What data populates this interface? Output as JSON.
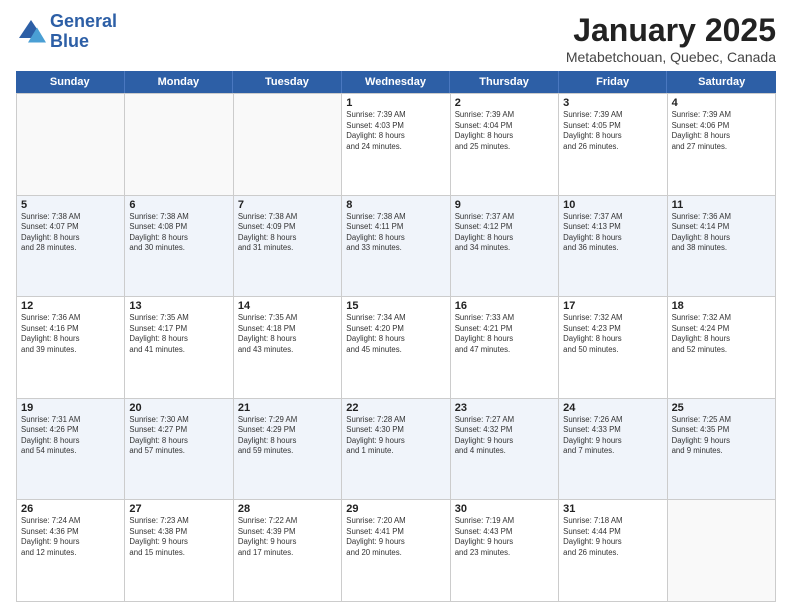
{
  "header": {
    "logo_general": "General",
    "logo_blue": "Blue",
    "month_title": "January 2025",
    "subtitle": "Metabetchouan, Quebec, Canada"
  },
  "weekdays": [
    "Sunday",
    "Monday",
    "Tuesday",
    "Wednesday",
    "Thursday",
    "Friday",
    "Saturday"
  ],
  "weeks": [
    [
      {
        "day": "",
        "info": ""
      },
      {
        "day": "",
        "info": ""
      },
      {
        "day": "",
        "info": ""
      },
      {
        "day": "1",
        "info": "Sunrise: 7:39 AM\nSunset: 4:03 PM\nDaylight: 8 hours\nand 24 minutes."
      },
      {
        "day": "2",
        "info": "Sunrise: 7:39 AM\nSunset: 4:04 PM\nDaylight: 8 hours\nand 25 minutes."
      },
      {
        "day": "3",
        "info": "Sunrise: 7:39 AM\nSunset: 4:05 PM\nDaylight: 8 hours\nand 26 minutes."
      },
      {
        "day": "4",
        "info": "Sunrise: 7:39 AM\nSunset: 4:06 PM\nDaylight: 8 hours\nand 27 minutes."
      }
    ],
    [
      {
        "day": "5",
        "info": "Sunrise: 7:38 AM\nSunset: 4:07 PM\nDaylight: 8 hours\nand 28 minutes."
      },
      {
        "day": "6",
        "info": "Sunrise: 7:38 AM\nSunset: 4:08 PM\nDaylight: 8 hours\nand 30 minutes."
      },
      {
        "day": "7",
        "info": "Sunrise: 7:38 AM\nSunset: 4:09 PM\nDaylight: 8 hours\nand 31 minutes."
      },
      {
        "day": "8",
        "info": "Sunrise: 7:38 AM\nSunset: 4:11 PM\nDaylight: 8 hours\nand 33 minutes."
      },
      {
        "day": "9",
        "info": "Sunrise: 7:37 AM\nSunset: 4:12 PM\nDaylight: 8 hours\nand 34 minutes."
      },
      {
        "day": "10",
        "info": "Sunrise: 7:37 AM\nSunset: 4:13 PM\nDaylight: 8 hours\nand 36 minutes."
      },
      {
        "day": "11",
        "info": "Sunrise: 7:36 AM\nSunset: 4:14 PM\nDaylight: 8 hours\nand 38 minutes."
      }
    ],
    [
      {
        "day": "12",
        "info": "Sunrise: 7:36 AM\nSunset: 4:16 PM\nDaylight: 8 hours\nand 39 minutes."
      },
      {
        "day": "13",
        "info": "Sunrise: 7:35 AM\nSunset: 4:17 PM\nDaylight: 8 hours\nand 41 minutes."
      },
      {
        "day": "14",
        "info": "Sunrise: 7:35 AM\nSunset: 4:18 PM\nDaylight: 8 hours\nand 43 minutes."
      },
      {
        "day": "15",
        "info": "Sunrise: 7:34 AM\nSunset: 4:20 PM\nDaylight: 8 hours\nand 45 minutes."
      },
      {
        "day": "16",
        "info": "Sunrise: 7:33 AM\nSunset: 4:21 PM\nDaylight: 8 hours\nand 47 minutes."
      },
      {
        "day": "17",
        "info": "Sunrise: 7:32 AM\nSunset: 4:23 PM\nDaylight: 8 hours\nand 50 minutes."
      },
      {
        "day": "18",
        "info": "Sunrise: 7:32 AM\nSunset: 4:24 PM\nDaylight: 8 hours\nand 52 minutes."
      }
    ],
    [
      {
        "day": "19",
        "info": "Sunrise: 7:31 AM\nSunset: 4:26 PM\nDaylight: 8 hours\nand 54 minutes."
      },
      {
        "day": "20",
        "info": "Sunrise: 7:30 AM\nSunset: 4:27 PM\nDaylight: 8 hours\nand 57 minutes."
      },
      {
        "day": "21",
        "info": "Sunrise: 7:29 AM\nSunset: 4:29 PM\nDaylight: 8 hours\nand 59 minutes."
      },
      {
        "day": "22",
        "info": "Sunrise: 7:28 AM\nSunset: 4:30 PM\nDaylight: 9 hours\nand 1 minute."
      },
      {
        "day": "23",
        "info": "Sunrise: 7:27 AM\nSunset: 4:32 PM\nDaylight: 9 hours\nand 4 minutes."
      },
      {
        "day": "24",
        "info": "Sunrise: 7:26 AM\nSunset: 4:33 PM\nDaylight: 9 hours\nand 7 minutes."
      },
      {
        "day": "25",
        "info": "Sunrise: 7:25 AM\nSunset: 4:35 PM\nDaylight: 9 hours\nand 9 minutes."
      }
    ],
    [
      {
        "day": "26",
        "info": "Sunrise: 7:24 AM\nSunset: 4:36 PM\nDaylight: 9 hours\nand 12 minutes."
      },
      {
        "day": "27",
        "info": "Sunrise: 7:23 AM\nSunset: 4:38 PM\nDaylight: 9 hours\nand 15 minutes."
      },
      {
        "day": "28",
        "info": "Sunrise: 7:22 AM\nSunset: 4:39 PM\nDaylight: 9 hours\nand 17 minutes."
      },
      {
        "day": "29",
        "info": "Sunrise: 7:20 AM\nSunset: 4:41 PM\nDaylight: 9 hours\nand 20 minutes."
      },
      {
        "day": "30",
        "info": "Sunrise: 7:19 AM\nSunset: 4:43 PM\nDaylight: 9 hours\nand 23 minutes."
      },
      {
        "day": "31",
        "info": "Sunrise: 7:18 AM\nSunset: 4:44 PM\nDaylight: 9 hours\nand 26 minutes."
      },
      {
        "day": "",
        "info": ""
      }
    ]
  ]
}
